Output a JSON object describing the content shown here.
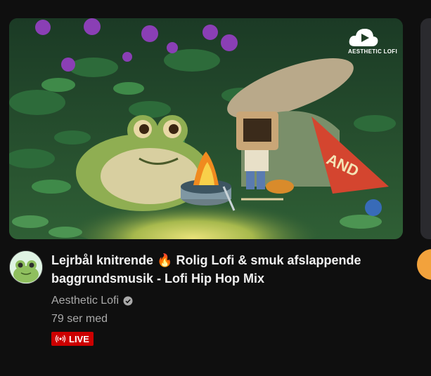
{
  "video": {
    "title": "Lejrbål knitrende 🔥 Rolig Lofi & smuk afslappende baggrundsmusik - Lofi Hip Hop Mix",
    "channel": "Aesthetic Lofi",
    "viewers": "79 ser med",
    "live_label": "LIVE",
    "thumbnail_logo_text": "AESTHETIC LOFI",
    "thumbnail_can_text": "AND"
  },
  "colors": {
    "background": "#0f0f0f",
    "primary_text": "#f1f1f1",
    "secondary_text": "#aaaaaa",
    "live_badge": "#cc0000"
  },
  "icons": {
    "verified": "verified-check-icon",
    "live": "live-broadcast-icon",
    "logo": "cloud-play-icon"
  }
}
